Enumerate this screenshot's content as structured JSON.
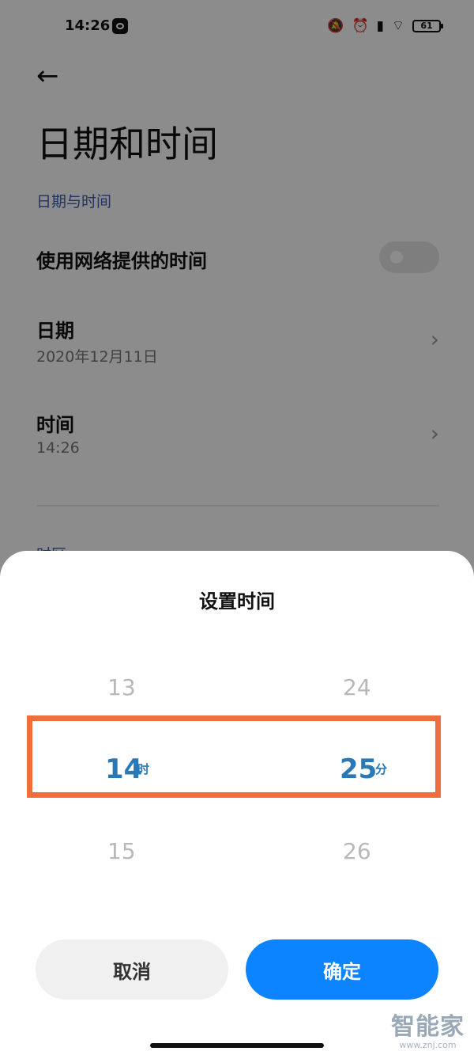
{
  "status_bar": {
    "time": "14:26",
    "battery": "61",
    "icons": [
      "mute-icon",
      "alarm-icon",
      "hd-signal-icon",
      "wifi-icon",
      "battery-icon"
    ]
  },
  "header": {
    "title": "日期和时间"
  },
  "section": {
    "label": "日期与时间"
  },
  "network_time": {
    "label": "使用网络提供的时间",
    "enabled": false
  },
  "date_row": {
    "title": "日期",
    "value": "2020年12月11日"
  },
  "time_row": {
    "title": "时间",
    "value": "14:26"
  },
  "peek_label": "时区",
  "time_picker": {
    "title": "设置时间",
    "hours": {
      "prev": "13",
      "selected": "14",
      "next": "15",
      "unit": "时"
    },
    "minutes": {
      "prev": "24",
      "selected": "25",
      "next": "26",
      "unit": "分"
    },
    "cancel_label": "取消",
    "confirm_label": "确定"
  },
  "watermark": {
    "main": "智能家",
    "sub": "www.znj.com"
  },
  "colors": {
    "accent": "#0d84ff",
    "selected_value": "#2a78b6",
    "highlight_border": "#f06e3b"
  }
}
